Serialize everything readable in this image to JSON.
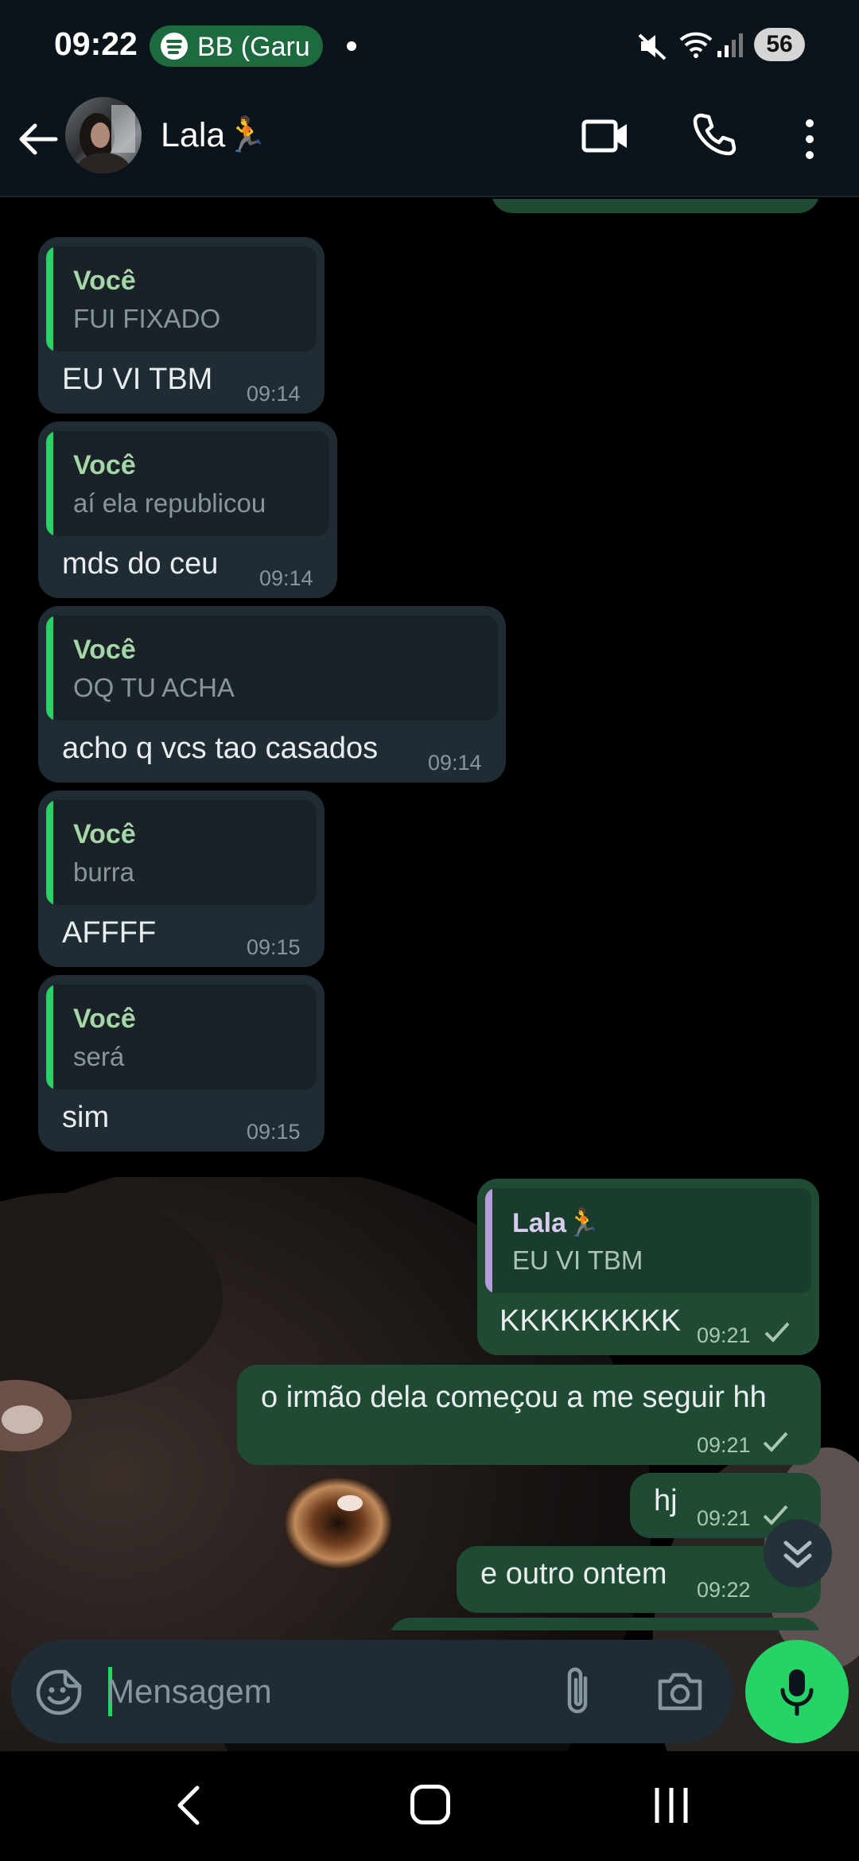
{
  "status_bar": {
    "time": "09:22",
    "media_label": "BB (Garu",
    "battery": "56"
  },
  "header": {
    "contact_name": "Lala🏃"
  },
  "messages": [
    {
      "direction": "in",
      "quote_author": "Você",
      "quote_text": "FUI FIXADO",
      "text": "EU VI TBM",
      "time": "09:14"
    },
    {
      "direction": "in",
      "quote_author": "Você",
      "quote_text": "aí ela republicou",
      "text": "mds do ceu",
      "time": "09:14"
    },
    {
      "direction": "in",
      "quote_author": "Você",
      "quote_text": "OQ TU ACHA",
      "text": "acho q vcs tao casados",
      "time": "09:14"
    },
    {
      "direction": "in",
      "quote_author": "Você",
      "quote_text": "burra",
      "text": "AFFFF",
      "time": "09:15"
    },
    {
      "direction": "in",
      "quote_author": "Você",
      "quote_text": "será",
      "text": "sim",
      "time": "09:15"
    },
    {
      "direction": "out",
      "quote_author": "Lala🏃",
      "quote_text": "EU VI TBM",
      "text": "KKKKKKKKK",
      "time": "09:21"
    },
    {
      "direction": "out",
      "text": "o irmão dela começou a me seguir hh",
      "time": "09:21"
    },
    {
      "direction": "out",
      "text": "hj",
      "time": "09:21"
    },
    {
      "direction": "out",
      "text": "e outro ontem",
      "time": "09:22"
    }
  ],
  "composer": {
    "placeholder": "Mensagem"
  },
  "colors": {
    "accent_green": "#25d366",
    "incoming_bubble": "#202c33",
    "outgoing_bubble": "#1f4a33",
    "quote_author_self": "#a5d6a7",
    "quote_author_contact": "#b39ddb"
  }
}
